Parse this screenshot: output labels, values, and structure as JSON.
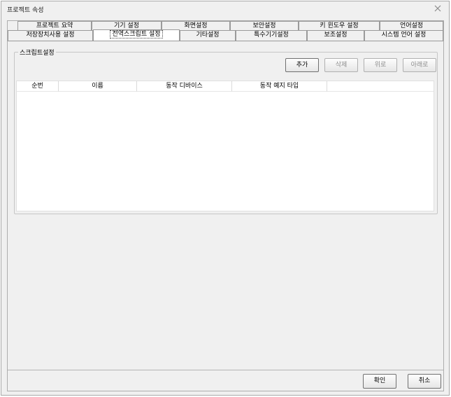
{
  "window": {
    "title": "프로젝트 속성"
  },
  "tabs": {
    "row1": [
      "프로젝트 요약",
      "기기 설정",
      "화면설정",
      "보안설정",
      "키 윈도우 설정",
      "언어설정"
    ],
    "row2": [
      "저장장치사용 설정",
      "전역스크립트 설정",
      "기타설정",
      "특수기기설정",
      "보조설정",
      "시스템 언어 설정"
    ],
    "active": "전역스크립트 설정"
  },
  "group": {
    "label": "스크립트설정"
  },
  "actions": {
    "add": "추가",
    "delete": "삭제",
    "up": "위로",
    "down": "아래로"
  },
  "table": {
    "columns": [
      "순번",
      "이름",
      "동작 디바이스",
      "동작 예지 타입"
    ],
    "rows": []
  },
  "footer": {
    "ok": "확인",
    "cancel": "취소"
  },
  "icons": {
    "close": "close-icon"
  }
}
